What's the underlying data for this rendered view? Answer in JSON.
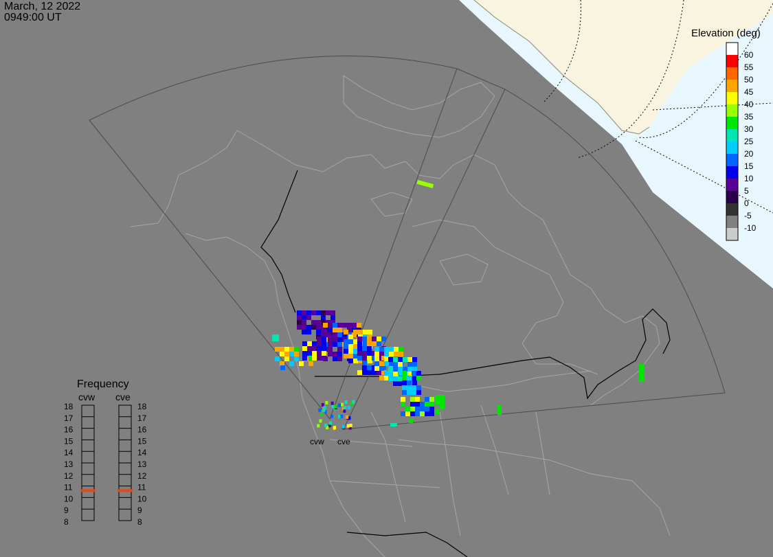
{
  "timestamp": {
    "date": "March, 12 2022",
    "time": "0949:00 UT"
  },
  "colors": {
    "background": "#808080",
    "ocean": "#e8f6fd",
    "land_sunlit": "#f8f4e0",
    "coastline": "#a6a6a6",
    "border": "#000000",
    "fov": "#4a4a4a",
    "frequency_marker": "#e24a1a"
  },
  "legend": {
    "title": "Elevation (deg)",
    "entries": [
      {
        "label": "60",
        "color": "#ffffff"
      },
      {
        "label": "55",
        "color": "#ff0000"
      },
      {
        "label": "50",
        "color": "#ff6600"
      },
      {
        "label": "45",
        "color": "#ffa500"
      },
      {
        "label": "40",
        "color": "#ffff00"
      },
      {
        "label": "35",
        "color": "#99ff00"
      },
      {
        "label": "30",
        "color": "#00e600"
      },
      {
        "label": "25",
        "color": "#00e6b3"
      },
      {
        "label": "20",
        "color": "#00ccff"
      },
      {
        "label": "15",
        "color": "#0066ff"
      },
      {
        "label": "10",
        "color": "#0000ee"
      },
      {
        "label": "5",
        "color": "#5a0096"
      },
      {
        "label": "0",
        "color": "#2d004d"
      },
      {
        "label": "-5",
        "color": "#333333"
      },
      {
        "label": "-10",
        "color": "#808080"
      },
      {
        "label": "",
        "color": "#cccccc"
      }
    ]
  },
  "frequency": {
    "title": "Frequency",
    "radars": [
      {
        "name": "cvw",
        "value_mhz": 10.6
      },
      {
        "name": "cve",
        "value_mhz": 10.6
      }
    ],
    "scale_labels": [
      "18",
      "17",
      "16",
      "15",
      "14",
      "13",
      "12",
      "11",
      "10",
      "9",
      "8"
    ]
  },
  "sites": [
    {
      "name": "cvw"
    },
    {
      "name": "cve"
    }
  ]
}
